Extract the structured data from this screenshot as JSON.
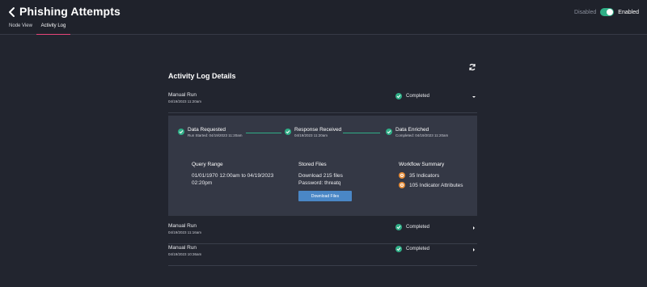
{
  "header": {
    "title": "Phishing Attempts",
    "toggle_off_label": "Disabled",
    "toggle_on_label": "Enabled",
    "toggle_state": "enabled",
    "back_icon": "chevron-left-icon"
  },
  "tabs": [
    {
      "label": "Node View",
      "active": false
    },
    {
      "label": "Activity Log",
      "active": true
    }
  ],
  "colors": {
    "accent_tab": "#e8457a",
    "success": "#2fae86",
    "warning": "#e98f3a",
    "primary_button": "#4a87c6"
  },
  "activity": {
    "title": "Activity Log Details",
    "refresh_icon": "refresh-icon",
    "runs": [
      {
        "name": "Manual Run",
        "date": "04/19/2023 11:20am",
        "status": "Completed",
        "expanded": true
      },
      {
        "name": "Manual Run",
        "date": "04/19/2023 11:16am",
        "status": "Completed",
        "expanded": false
      },
      {
        "name": "Manual Run",
        "date": "04/19/2023 10:36am",
        "status": "Completed",
        "expanded": false
      }
    ],
    "details": {
      "steps": [
        {
          "title": "Data Requested",
          "sub": "Run Started: 04/19/2023 11:20am"
        },
        {
          "title": "Response Received",
          "sub": "04/19/2023 11:20am"
        },
        {
          "title": "Data Enriched",
          "sub": "Completed: 04/19/2023 11:20am"
        }
      ],
      "query_range": {
        "title": "Query Range",
        "line1": "01/01/1970 12:00am to 04/19/2023",
        "line2": "02:20pm"
      },
      "stored_files": {
        "title": "Stored Files",
        "line1": "Download 215 files",
        "line2": "Password: threatq",
        "button": "Download Files"
      },
      "workflow_summary": {
        "title": "Workflow Summary",
        "items": [
          "35 Indicators",
          "105 Indicator Attributes"
        ]
      }
    }
  }
}
